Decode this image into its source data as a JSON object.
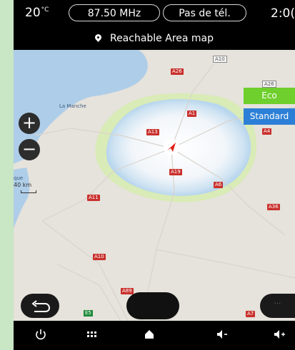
{
  "status": {
    "temperature": "20",
    "temperature_unit": "°C",
    "radio": "87.50 MHz",
    "phone": "Pas de tél.",
    "clock": "2:0("
  },
  "title": "Reachable Area map",
  "map": {
    "places": [
      "La Manche",
      "que"
    ],
    "scale": "40 km",
    "roads": {
      "a10_top": "A10",
      "a26_top": "A26",
      "a26_right": "A26",
      "a1": "A1",
      "a4": "A4",
      "a13": "A13",
      "a19": "A19",
      "a6": "A6",
      "a36": "A36",
      "a11": "A11",
      "a10_bottom": "A10",
      "a89": "A89",
      "e5": "E5",
      "a7": "A7"
    }
  },
  "modes": {
    "eco": "Eco",
    "standard": "Standard"
  },
  "buttons": {
    "zoom_in": "+",
    "zoom_out": "−",
    "more": "···"
  },
  "icons": [
    "power-icon",
    "apps-grid-icon",
    "home-icon",
    "volume-down-icon",
    "volume-up-icon"
  ],
  "colors": {
    "eco": "#6fcf2c",
    "standard": "#2c7fd6",
    "road": "#c9302c",
    "range_outer": "#d8ecb4",
    "range_inner": "#cfe3f2"
  }
}
